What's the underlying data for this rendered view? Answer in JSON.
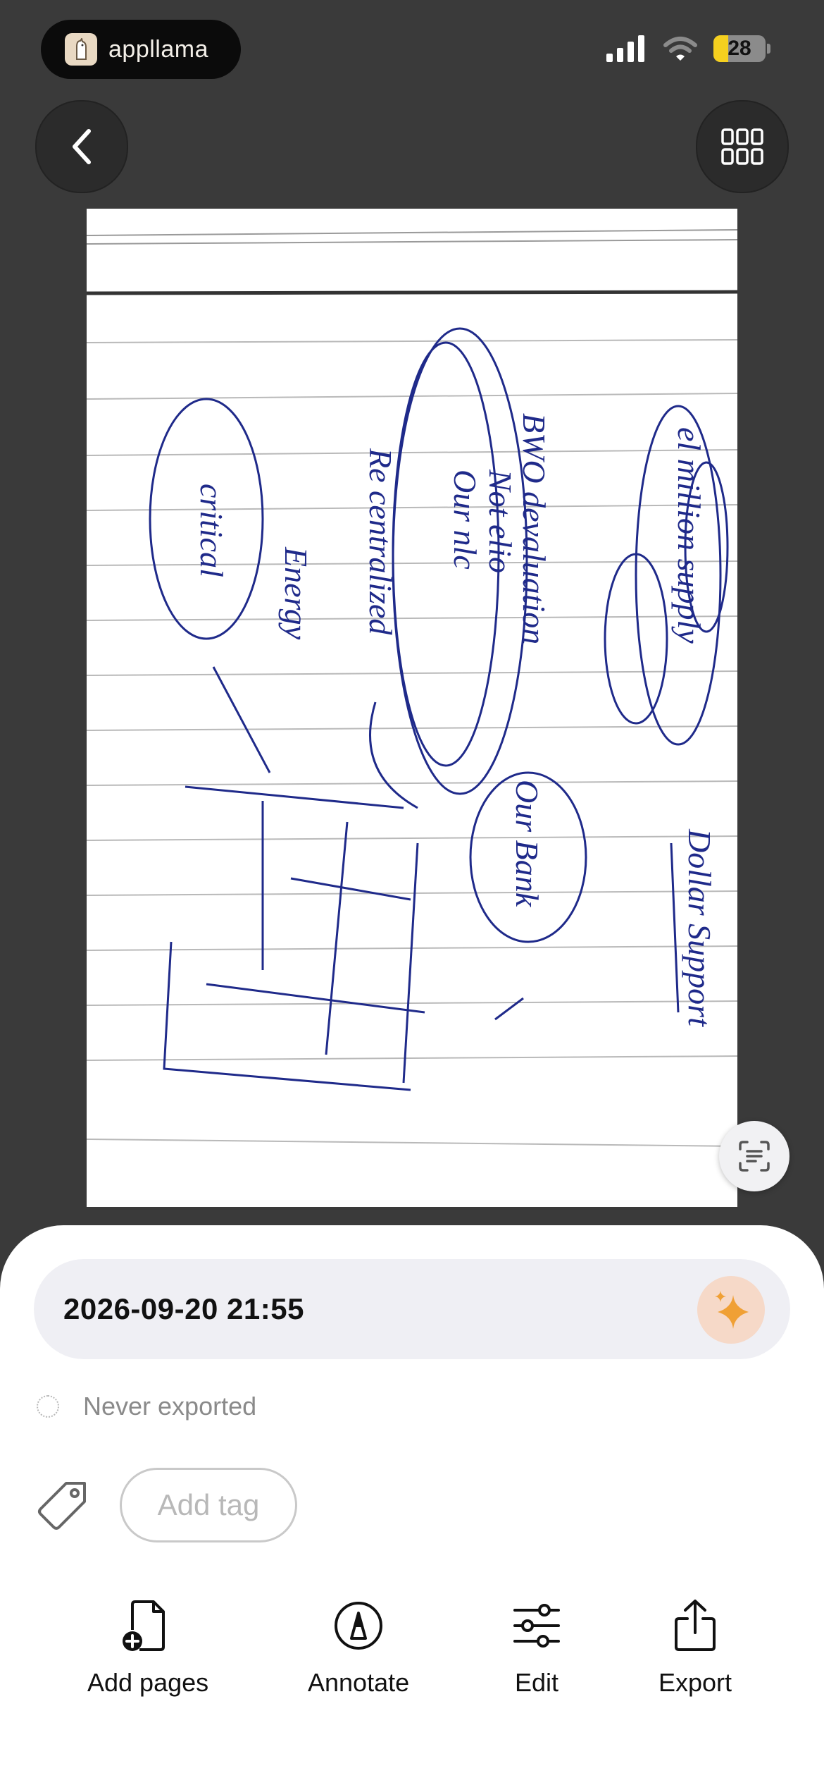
{
  "status_bar": {
    "app_name": "appllama",
    "battery": "28",
    "battery_level": 0.28
  },
  "document": {
    "timestamp_title": "2026-09-20 21:55",
    "export_status": "Never exported",
    "add_tag_label": "Add tag",
    "handwriting": {
      "lines": [
        "el million supply",
        "BWO devaluation",
        "Not elio",
        "Our nlc",
        "Re centralized",
        "Energy",
        "critical",
        "Our Bank",
        "Dollar Support"
      ]
    }
  },
  "toolbar": {
    "add_pages": "Add pages",
    "annotate": "Annotate",
    "edit": "Edit",
    "export": "Export"
  },
  "colors": {
    "background": "#3a3a3a",
    "ink": "#1f2a8a",
    "sheet": "#ffffff",
    "accent": "#f0a035"
  },
  "icons": [
    "back-icon",
    "grid-icon",
    "scan-text-icon",
    "sparkle-icon",
    "tag-icon",
    "add-page-icon",
    "annotate-icon",
    "sliders-icon",
    "share-icon"
  ]
}
